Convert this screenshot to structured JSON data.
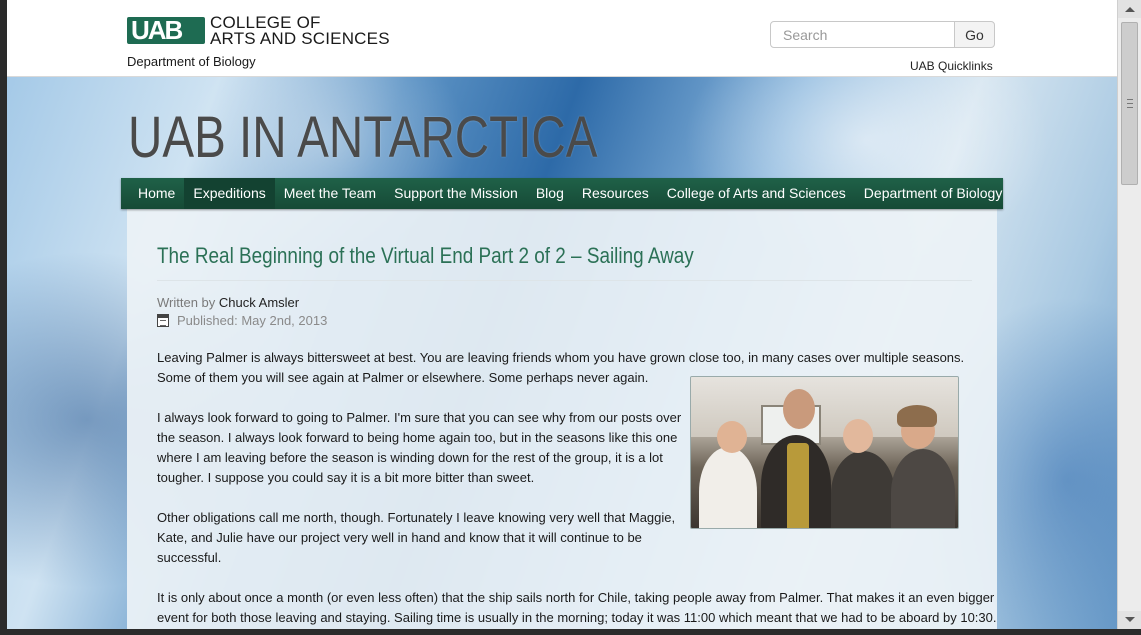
{
  "header": {
    "logo_mark": "UAB",
    "logo_line1": "COLLEGE OF",
    "logo_line2": "ARTS AND SCIENCES",
    "department": "Department of Biology",
    "search_placeholder": "Search",
    "go_label": "Go",
    "quicklinks_label": "UAB Quicklinks"
  },
  "site_title": "UAB IN ANTARCTICA",
  "nav": {
    "items": [
      {
        "label": "Home"
      },
      {
        "label": "Expeditions"
      },
      {
        "label": "Meet the Team"
      },
      {
        "label": "Support the Mission"
      },
      {
        "label": "Blog"
      },
      {
        "label": "Resources"
      },
      {
        "label": "College of Arts and Sciences"
      },
      {
        "label": "Department of Biology"
      }
    ],
    "active": "Expeditions"
  },
  "article": {
    "title": "The Real Beginning of the Virtual End Part 2 of 2 – Sailing Away",
    "written_by_label": "Written by",
    "author": "Chuck Amsler",
    "published": "Published: May 2nd, 2013",
    "paragraphs": [
      "Leaving Palmer is always bittersweet at best. You are leaving friends whom you have grown close too, in many cases over multiple seasons.",
      "Some of them you will see again at Palmer or elsewhere. Some perhaps never again.",
      "I always look forward to going to Palmer. I'm sure that you can see why from our posts over",
      "the season. I always look forward to being home again too, but in the seasons like this one",
      "where I am leaving before the season is winding down for the rest of the group, it is a lot",
      "tougher. I suppose you could say it is a bit more bitter than sweet.",
      "Other obligations call me north, though. Fortunately I leave knowing very well that Maggie,",
      "Kate, and Julie have our project very well in hand and know that it will continue to be",
      "successful.",
      "It is only about once a month (or even less often) that the ship sails north for Chile, taking people away from Palmer. That makes it an even bigger",
      "event for both those leaving and staying. Sailing time is usually in the morning; today it was 11:00 which meant that we had to be aboard by 10:30."
    ]
  },
  "colors": {
    "nav_bg": "#1f6148",
    "title_green": "#2b7156",
    "logo_green": "#1e6b52"
  }
}
